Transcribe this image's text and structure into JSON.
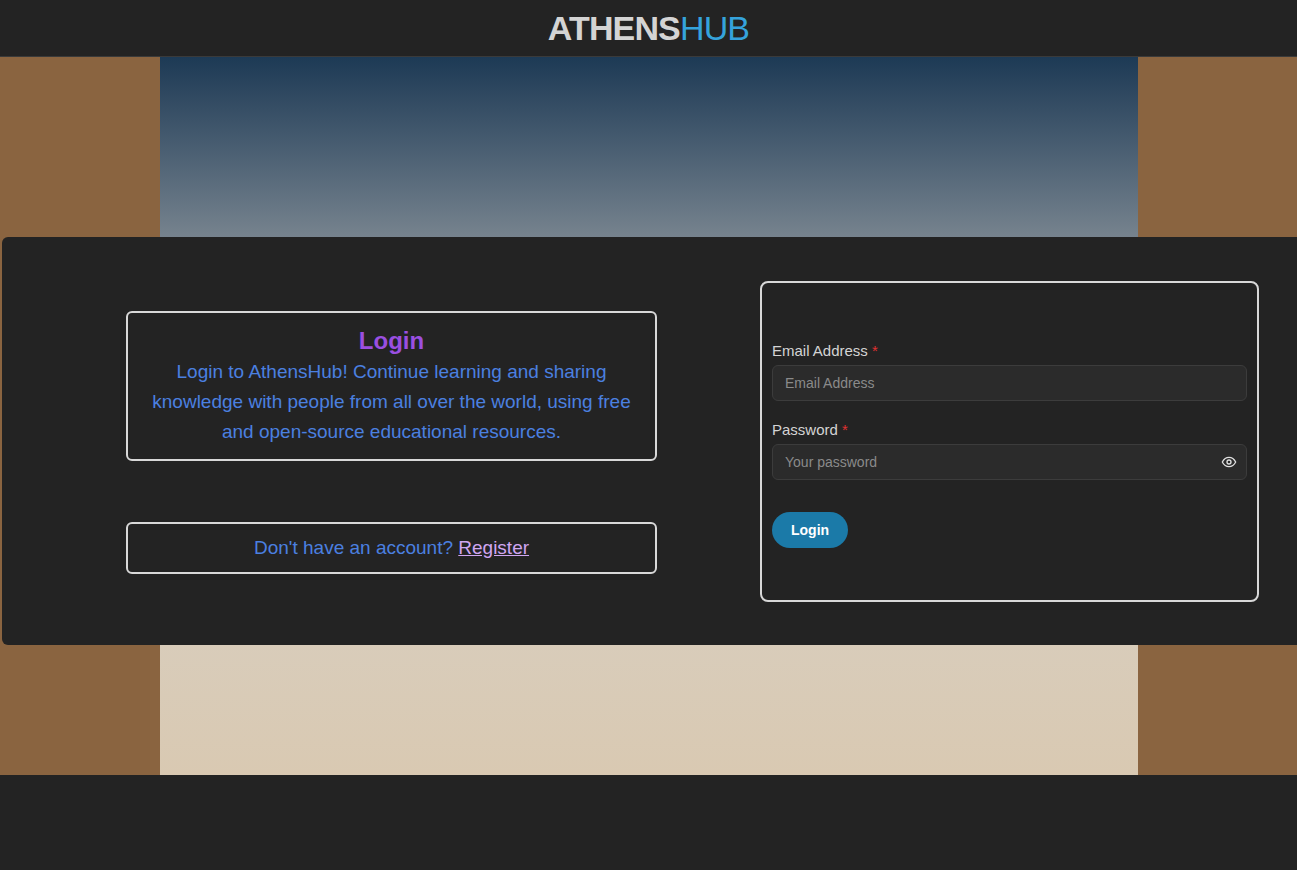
{
  "header": {
    "logo_left": "ATHENS",
    "logo_right": "HUB"
  },
  "intro": {
    "title": "Login",
    "text": "Login to AthensHub! Continue learning and sharing knowledge with people from all over the world, using free and open-source educational resources."
  },
  "register": {
    "prompt": "Don't have an account?",
    "link": "Register"
  },
  "form": {
    "fields": [
      {
        "label": "Email Address",
        "required": "*",
        "placeholder": "Email Address",
        "kind": "text"
      },
      {
        "label": "Password",
        "required": "*",
        "placeholder": "Your password",
        "kind": "password"
      }
    ],
    "submit": "Login"
  }
}
